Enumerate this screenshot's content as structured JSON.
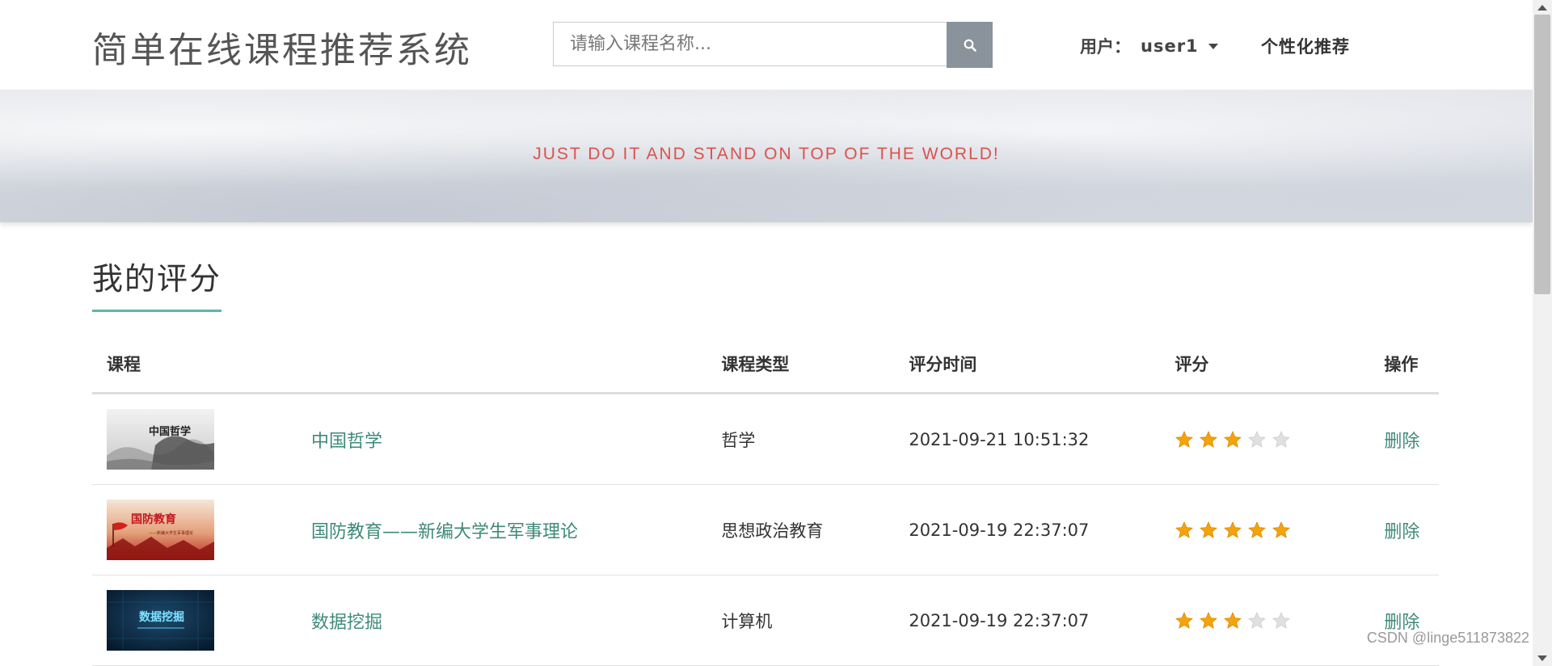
{
  "header": {
    "site_title": "简单在线课程推荐系统",
    "search_placeholder": "请输入课程名称...",
    "search_icon": "search-icon",
    "user_label": "用户：",
    "user_name": "user1",
    "recommend_link": "个性化推荐"
  },
  "banner": {
    "slogan": "JUST DO IT AND STAND ON TOP OF THE WORLD!"
  },
  "section": {
    "title": "我的评分"
  },
  "table": {
    "headers": {
      "course": "课程",
      "type": "课程类型",
      "time": "评分时间",
      "rating": "评分",
      "action": "操作"
    },
    "max_stars": 5,
    "rows": [
      {
        "thumb_text": "中国哲学",
        "thumb_theme": "ink-landscape",
        "name": "中国哲学",
        "type": "哲学",
        "time": "2021-09-21 10:51:32",
        "rating": 3,
        "action": "删除"
      },
      {
        "thumb_text": "国防教育",
        "thumb_subtext": "——新编大学生军事理论",
        "thumb_theme": "red-flag",
        "name": "国防教育——新编大学生军事理论",
        "type": "思想政治教育",
        "time": "2021-09-19 22:37:07",
        "rating": 5,
        "action": "删除"
      },
      {
        "thumb_text": "数据挖掘",
        "thumb_theme": "tech-blue",
        "name": "数据挖掘",
        "type": "计算机",
        "time": "2021-09-19 22:37:07",
        "rating": 3,
        "action": "删除"
      }
    ]
  },
  "watermark": "CSDN @linge511873822",
  "colors": {
    "accent": "#3e8a79",
    "underline": "#5cb8a5",
    "slogan": "#d9534f",
    "star_filled": "#f5a30a",
    "star_empty": "#e0e0e0",
    "search_button": "#8a939b"
  }
}
